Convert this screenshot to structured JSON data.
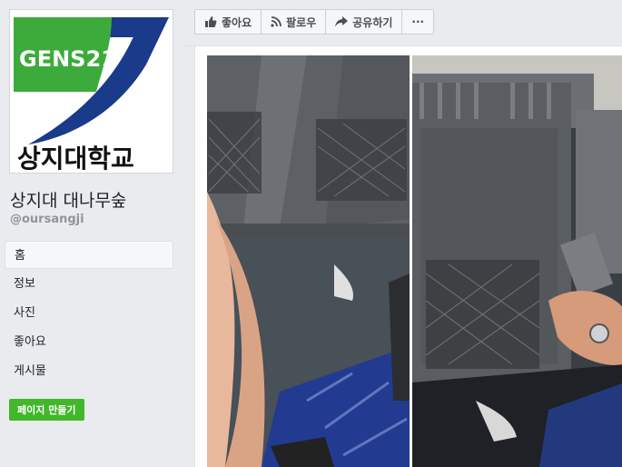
{
  "sidebar": {
    "logo_text": "GENS21",
    "logo_caption": "상지대학교",
    "page_name": "상지대 대나무숲",
    "page_handle": "@oursangji",
    "nav_items": [
      {
        "label": "홈",
        "active": true
      },
      {
        "label": "정보",
        "active": false
      },
      {
        "label": "사진",
        "active": false
      },
      {
        "label": "좋아요",
        "active": false
      },
      {
        "label": "게시물",
        "active": false
      }
    ],
    "create_page_label": "페이지 만들기"
  },
  "actions": {
    "like_label": "좋아요",
    "follow_label": "팔로우",
    "share_label": "공유하기",
    "more_label": "···"
  },
  "colors": {
    "create_button": "#42b72a",
    "logo_green": "#3cab3c",
    "logo_blue": "#1a3a8a"
  }
}
